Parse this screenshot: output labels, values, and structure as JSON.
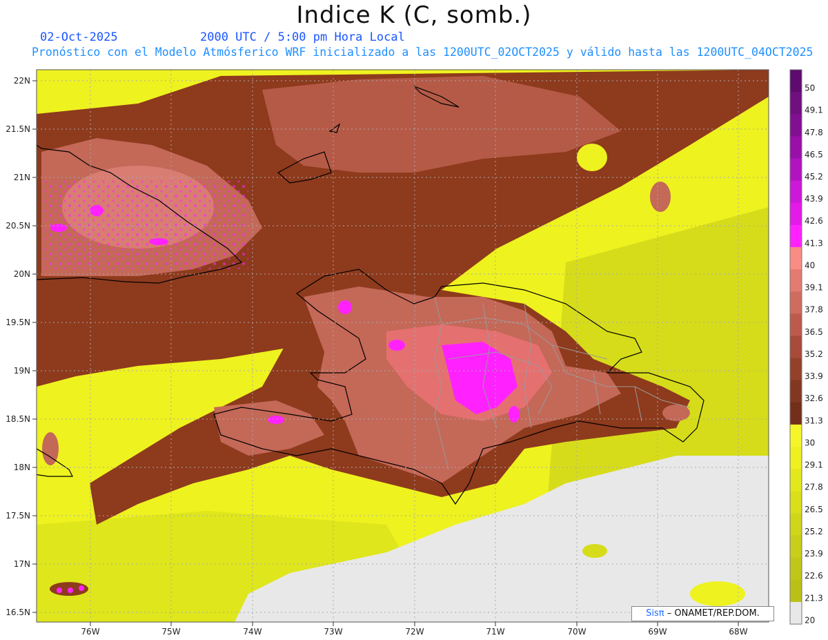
{
  "header": {
    "title": "Indice K (C, somb.)",
    "date": "02-Oct-2025",
    "time": "2000 UTC / 5:00 pm Hora Local",
    "description": "Pronóstico con el Modelo Atmósferico WRF inicializado a las 1200UTC_02OCT2025 y válido hasta las  1200UTC_04OCT2025"
  },
  "map": {
    "lat_labels": [
      "22N",
      "21.5N",
      "21N",
      "20.5N",
      "20N",
      "19.5N",
      "19N",
      "18.5N",
      "18N",
      "17.5N",
      "17N",
      "16.5N"
    ],
    "lon_labels": [
      "76W",
      "75W",
      "74W",
      "73W",
      "72W",
      "71W",
      "70W",
      "69W",
      "68W"
    ],
    "colors": {
      "ocean_low": "#eef21f",
      "mid": "#c8c418",
      "brown": "#8e3a1d",
      "salmon": "#c46858",
      "pink": "#e57070",
      "magenta": "#ff22ff",
      "no_data": "#e8e8e8",
      "coast": "#000000",
      "borders": "#9a9a9a"
    }
  },
  "colorbar": {
    "labels": [
      "50",
      "49.1",
      "47.8",
      "46.5",
      "45.2",
      "43.9",
      "42.6",
      "41.3",
      "40",
      "39.1",
      "37.8",
      "36.5",
      "35.2",
      "33.9",
      "32.6",
      "31.3",
      "30",
      "29.1",
      "27.8",
      "26.5",
      "25.2",
      "23.9",
      "22.6",
      "21.3",
      "20"
    ],
    "colors": [
      "#5e0a6e",
      "#6f0f80",
      "#820f92",
      "#9a0fa8",
      "#b213c0",
      "#cc18d8",
      "#e31ae8",
      "#ff22ff",
      "#fa8c86",
      "#e37b70",
      "#cf6c5e",
      "#bc5b4c",
      "#a84b3a",
      "#94412a",
      "#823820",
      "#742f1a",
      "#f5f52a",
      "#eef01f",
      "#e3e81c",
      "#d9df1a",
      "#d0d61a",
      "#c8ce19",
      "#c1c718",
      "#bbc017",
      "#e8e8e8"
    ]
  },
  "credit": {
    "logo": "Sisπ",
    "text": "– ONAMET/REP.DOM."
  }
}
